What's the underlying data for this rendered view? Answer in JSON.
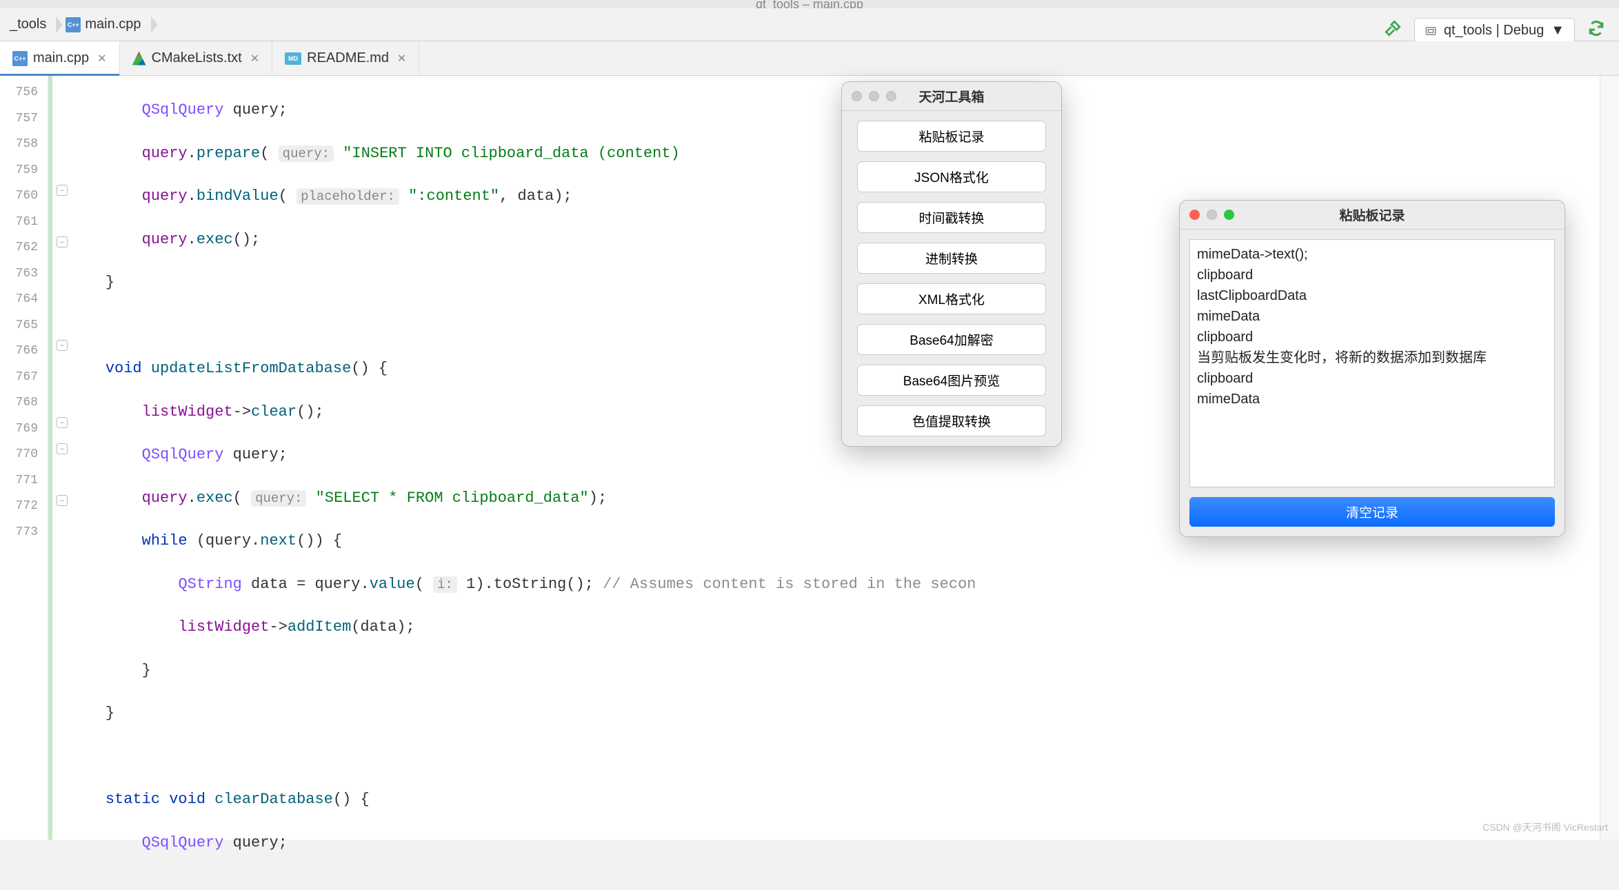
{
  "titlebar": "qt_tools – main.cpp",
  "breadcrumb": {
    "project": "_tools",
    "file": "main.cpp"
  },
  "run_config": "qt_tools | Debug",
  "tabs": [
    {
      "label": "main.cpp",
      "active": true
    },
    {
      "label": "CMakeLists.txt",
      "active": false
    },
    {
      "label": "README.md",
      "active": false
    }
  ],
  "line_start": 756,
  "code": {
    "l756": {
      "indent": "        ",
      "type": "QSqlQuery",
      "var": " query;"
    },
    "l757": {
      "indent": "        ",
      "obj": "query",
      "dot": ".",
      "m": "prepare",
      "open": "( ",
      "hint": "query:",
      "str": " \"INSERT INTO clipboard_data (content) "
    },
    "l758": {
      "indent": "        ",
      "obj": "query",
      "dot": ".",
      "m": "bindValue",
      "open": "( ",
      "hint": "placeholder:",
      "str": " \":content\"",
      "rest": ", data);"
    },
    "l759": {
      "indent": "        ",
      "obj": "query",
      "dot": ".",
      "m": "exec",
      "rest": "();"
    },
    "l760": {
      "indent": "    ",
      "brace": "}"
    },
    "l761": {
      "indent": ""
    },
    "l762": {
      "indent": "    ",
      "kw": "void",
      "fn": " updateListFromDatabase",
      "rest": "() {"
    },
    "l763": {
      "indent": "        ",
      "obj": "listWidget",
      "arrow": "->",
      "m": "clear",
      "rest": "();"
    },
    "l764": {
      "indent": "        ",
      "type": "QSqlQuery",
      "var": " query;"
    },
    "l765": {
      "indent": "        ",
      "obj": "query",
      "dot": ".",
      "m": "exec",
      "open": "( ",
      "hint": "query:",
      "str": " \"SELECT * FROM clipboard_data\"",
      "rest": ");"
    },
    "l766": {
      "indent": "        ",
      "kw": "while",
      "rest1": " (query.",
      "m": "next",
      "rest2": "()) {"
    },
    "l767": {
      "indent": "            ",
      "type": "QString",
      "var": " data = query.",
      "m": "value",
      "open": "( ",
      "hint": "i:",
      "arg": " 1",
      "rest": ").toString(); ",
      "comment": "// Assumes content is stored in the secon"
    },
    "l768": {
      "indent": "            ",
      "obj": "listWidget",
      "arrow": "->",
      "m": "addItem",
      "rest": "(data);"
    },
    "l769": {
      "indent": "        ",
      "brace": "}"
    },
    "l770": {
      "indent": "    ",
      "brace": "}"
    },
    "l771": {
      "indent": ""
    },
    "l772": {
      "indent": "    ",
      "kw1": "static",
      "kw2": " void",
      "fn": " clearDatabase",
      "rest": "() {"
    },
    "l773": {
      "indent": "        ",
      "type": "QSqlQuery",
      "var": " query;"
    }
  },
  "tool_window": {
    "title": "天河工具箱",
    "buttons": [
      "粘贴板记录",
      "JSON格式化",
      "时间戳转换",
      "进制转换",
      "XML格式化",
      "Base64加解密",
      "Base64图片预览",
      "色值提取转换"
    ]
  },
  "clip_window": {
    "title": "粘贴板记录",
    "items": [
      "mimeData->text();",
      "clipboard",
      "lastClipboardData",
      "mimeData",
      "clipboard",
      "当剪贴板发生变化时，将新的数据添加到数据库",
      "clipboard",
      "mimeData"
    ],
    "clear_btn": "清空记录"
  },
  "watermark": "CSDN @天河书阁 VicRestart"
}
